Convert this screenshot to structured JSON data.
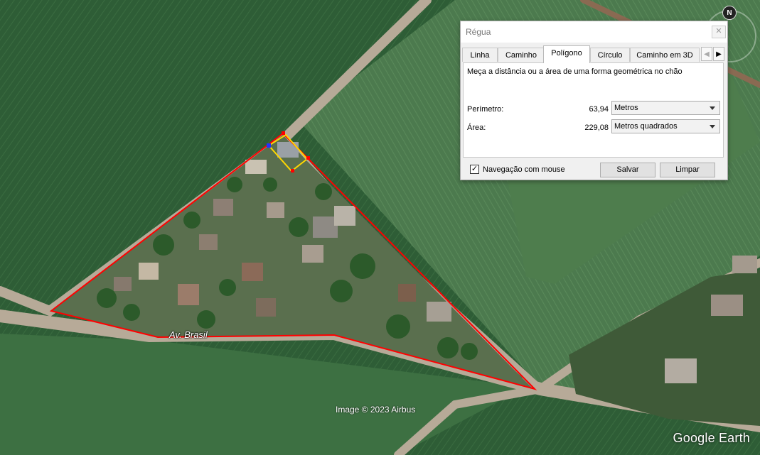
{
  "map": {
    "street_label": "Av. Brasil",
    "copyright": "Image © 2023 Airbus",
    "brand": "Google Earth",
    "compass_letter": "N",
    "measure_line_color": "#ff0000",
    "selection_color": "#ffd700"
  },
  "dialog": {
    "title": "Régua",
    "close_label": "✕",
    "tabs": [
      {
        "label": "Linha"
      },
      {
        "label": "Caminho"
      },
      {
        "label": "Polígono"
      },
      {
        "label": "Círculo"
      },
      {
        "label": "Caminho em 3D"
      }
    ],
    "active_tab": "Polígono",
    "tab_scroll_left": "◀",
    "tab_scroll_right": "▶",
    "description": "Meça a distância ou a área de uma forma geométrica no chão",
    "perimeter": {
      "label": "Perímetro:",
      "value": "63,94",
      "unit": "Metros"
    },
    "area": {
      "label": "Área:",
      "value": "229,08",
      "unit": "Metros quadrados"
    },
    "mouse_navigation": {
      "label": "Navegação com mouse",
      "checked": true,
      "check_mark": "✓"
    },
    "save_label": "Salvar",
    "clear_label": "Limpar"
  }
}
